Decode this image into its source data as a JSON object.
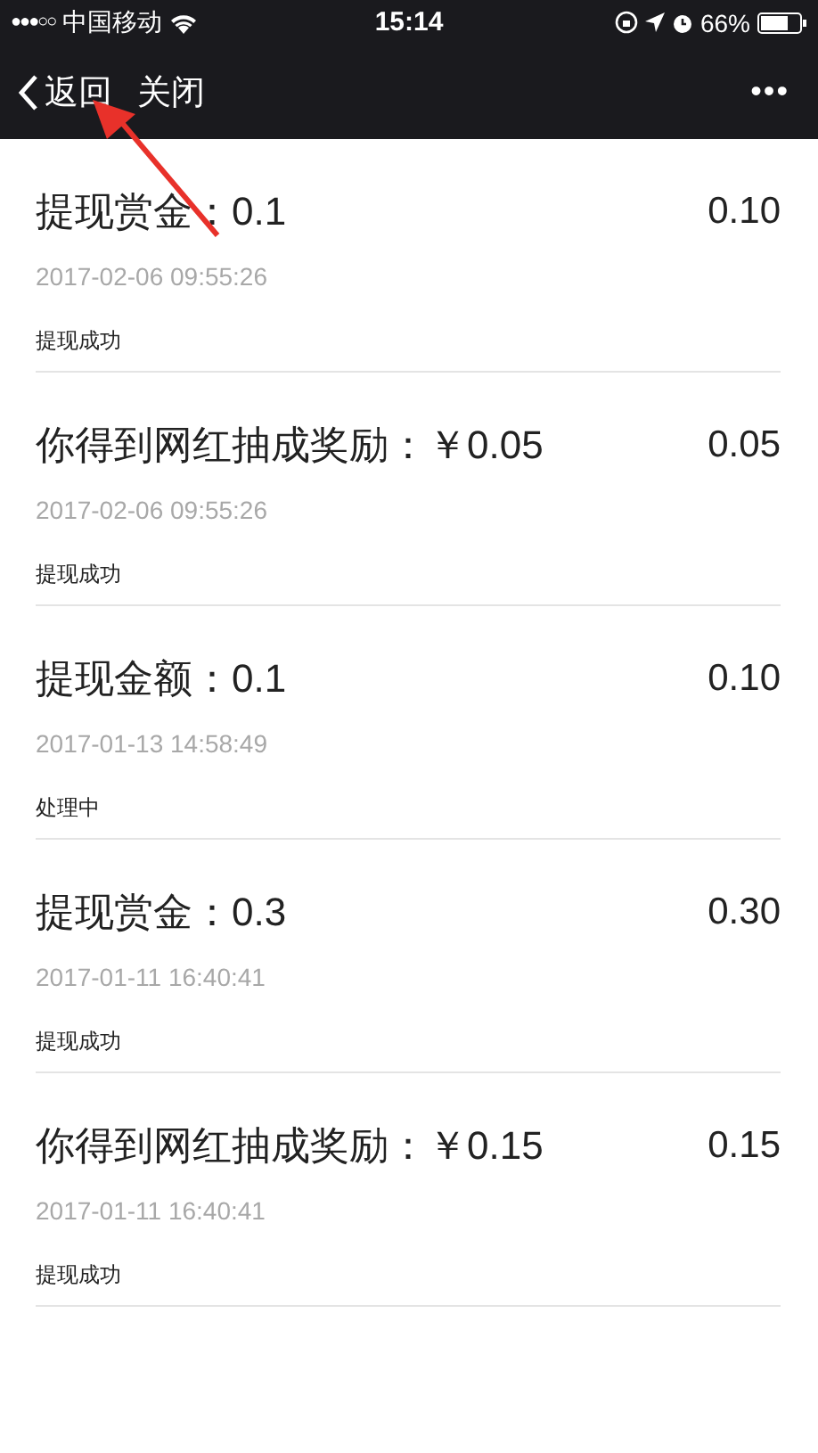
{
  "status_bar": {
    "signal": "●●●○○",
    "carrier": "中国移动",
    "time": "15:14",
    "battery": "66%"
  },
  "nav": {
    "back": "返回",
    "close": "关闭",
    "more": "•••"
  },
  "records": [
    {
      "title": "提现赏金：0.1",
      "time": "2017-02-06 09:55:26",
      "status": "提现成功",
      "amount": "0.10"
    },
    {
      "title": "你得到网红抽成奖励：￥0.05",
      "time": "2017-02-06 09:55:26",
      "status": "提现成功",
      "amount": "0.05"
    },
    {
      "title": "提现金额：0.1",
      "time": "2017-01-13 14:58:49",
      "status": "处理中",
      "amount": "0.10"
    },
    {
      "title": "提现赏金：0.3",
      "time": "2017-01-11 16:40:41",
      "status": "提现成功",
      "amount": "0.30"
    },
    {
      "title": "你得到网红抽成奖励：￥0.15",
      "time": "2017-01-11 16:40:41",
      "status": "提现成功",
      "amount": "0.15"
    }
  ]
}
